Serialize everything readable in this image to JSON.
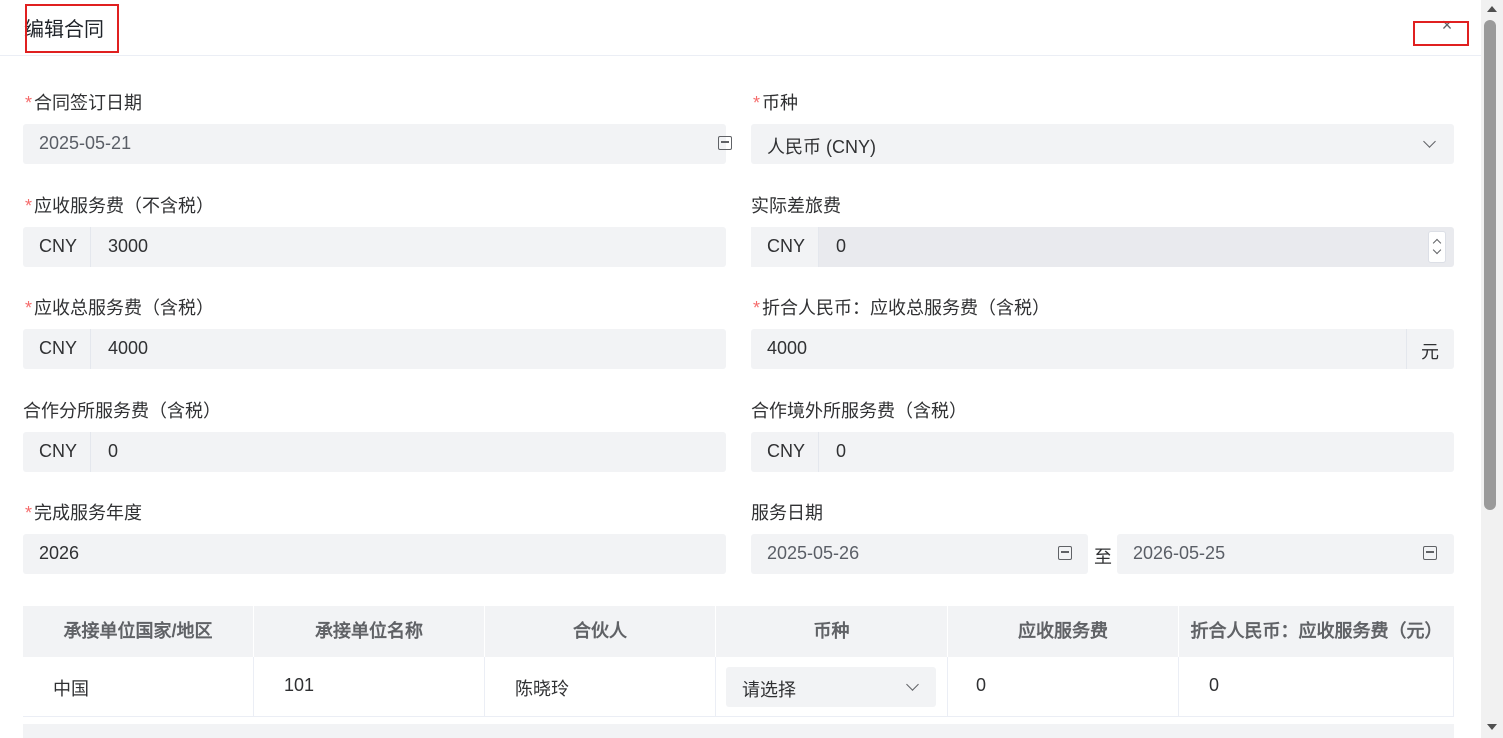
{
  "dialog": {
    "title": "编辑合同",
    "close_glyph": "×"
  },
  "form": {
    "sign_date": {
      "label": "合同签订日期",
      "value": "2025-05-21"
    },
    "currency": {
      "label": "币种",
      "value": "人民币 (CNY)"
    },
    "receivable_fee_excl_tax": {
      "label": "应收服务费（不含税）",
      "prefix": "CNY",
      "value": "3000"
    },
    "actual_travel_fee": {
      "label": "实际差旅费",
      "prefix": "CNY",
      "value": "0"
    },
    "receivable_total_incl_tax": {
      "label": "应收总服务费（含税）",
      "prefix": "CNY",
      "value": "4000"
    },
    "rmb_total_incl_tax": {
      "label": "折合人民币：应收总服务费（含税）",
      "value": "4000",
      "suffix": "元"
    },
    "branch_fee_incl_tax": {
      "label": "合作分所服务费（含税）",
      "prefix": "CNY",
      "value": "0"
    },
    "overseas_fee_incl_tax": {
      "label": "合作境外所服务费（含税）",
      "prefix": "CNY",
      "value": "0"
    },
    "completion_year": {
      "label": "完成服务年度",
      "value": "2026"
    },
    "service_period": {
      "label": "服务日期",
      "start": "2025-05-26",
      "separator": "至",
      "end": "2026-05-25"
    },
    "required_mark": "*"
  },
  "table": {
    "columns": [
      "承接单位国家/地区",
      "承接单位名称",
      "合伙人",
      "币种",
      "应收服务费",
      "折合人民币：应收服务费（元）"
    ],
    "rows": [
      {
        "country": "中国",
        "name": "101",
        "partner": "陈晓玲",
        "currency_placeholder": "请选择",
        "fee": "0",
        "rmb_fee": "0"
      }
    ]
  },
  "colors": {
    "required": "#f56c6c",
    "input_bg": "#f2f3f5",
    "highlight": "#e02020"
  }
}
